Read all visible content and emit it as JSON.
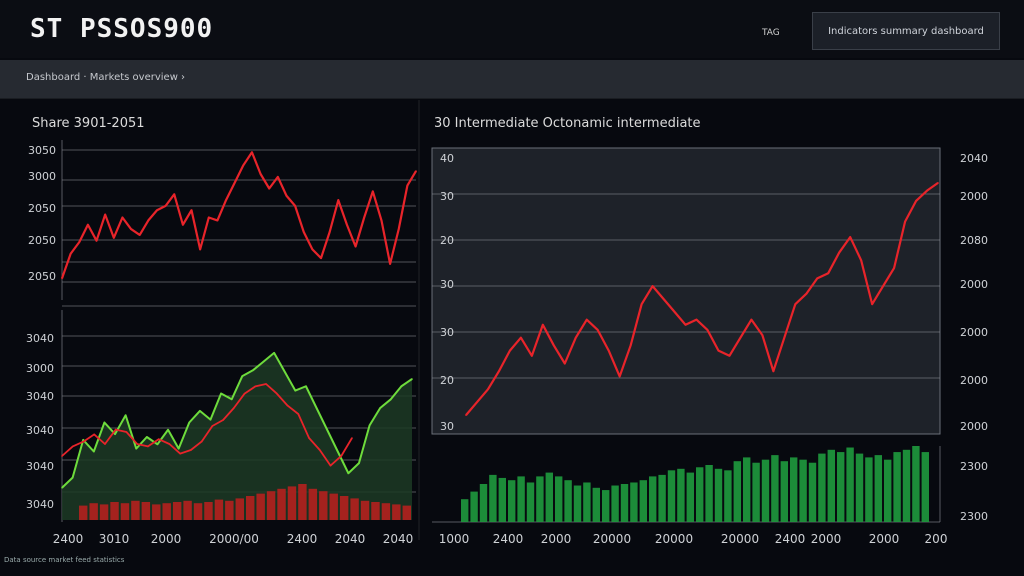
{
  "header": {
    "title": "ST PSSOS900",
    "right_label": "TAG",
    "action_button": "Indicators summary dashboard"
  },
  "subnav": {
    "breadcrumb": "Dashboard  ·  Markets overview ›"
  },
  "footer": {
    "text": "Data source market feed statistics"
  },
  "colors": {
    "red": "#e8242a",
    "green": "#6edc3c",
    "dark_green": "#1c3a24",
    "bar_red": "#b5201e",
    "bar_green": "#1f9b3e",
    "grid": "#8c8f96"
  },
  "chart_data": [
    {
      "type": "line",
      "title": "Share 3901-2051",
      "y_tick_labels": [
        "3050",
        "3000",
        "2050",
        "2050",
        "2050"
      ],
      "grid": true,
      "series": [
        {
          "color": "red",
          "values": [
            0.08,
            0.25,
            0.33,
            0.45,
            0.34,
            0.52,
            0.36,
            0.5,
            0.42,
            0.38,
            0.48,
            0.55,
            0.58,
            0.66,
            0.45,
            0.55,
            0.28,
            0.5,
            0.48,
            0.62,
            0.74,
            0.86,
            0.95,
            0.8,
            0.7,
            0.78,
            0.65,
            0.58,
            0.4,
            0.28,
            0.22,
            0.4,
            0.62,
            0.45,
            0.3,
            0.5,
            0.68,
            0.48,
            0.18,
            0.42,
            0.72,
            0.82
          ]
        }
      ]
    },
    {
      "type": "area",
      "y_tick_labels": [
        "3040",
        "3000",
        "3040",
        "3040",
        "3040",
        "3040"
      ],
      "x_tick_labels": [
        "2400",
        "3010",
        "2000",
        "2000/00",
        "2400",
        "2040",
        "2040"
      ],
      "grid": true,
      "series": [
        {
          "color": "green",
          "values": [
            0.05,
            0.12,
            0.38,
            0.3,
            0.5,
            0.42,
            0.55,
            0.32,
            0.4,
            0.35,
            0.45,
            0.32,
            0.5,
            0.58,
            0.52,
            0.7,
            0.66,
            0.82,
            0.86,
            0.92,
            0.98,
            0.85,
            0.72,
            0.75,
            0.6,
            0.45,
            0.3,
            0.15,
            0.22,
            0.48,
            0.6,
            0.66,
            0.75,
            0.8
          ]
        },
        {
          "color": "red",
          "values": [
            0.2,
            0.28,
            0.32,
            0.38,
            0.3,
            0.42,
            0.4,
            0.3,
            0.28,
            0.34,
            0.3,
            0.22,
            0.25,
            0.32,
            0.45,
            0.5,
            0.6,
            0.72,
            0.78,
            0.8,
            0.72,
            0.62,
            0.55,
            0.35,
            0.25,
            0.12,
            0.2,
            0.35
          ]
        }
      ],
      "volume": [
        0.12,
        0.14,
        0.13,
        0.15,
        0.14,
        0.16,
        0.15,
        0.13,
        0.14,
        0.15,
        0.16,
        0.14,
        0.15,
        0.17,
        0.16,
        0.18,
        0.2,
        0.22,
        0.24,
        0.26,
        0.28,
        0.3,
        0.26,
        0.24,
        0.22,
        0.2,
        0.18,
        0.16,
        0.15,
        0.14,
        0.13,
        0.12
      ]
    },
    {
      "type": "line",
      "title": "30 Intermediate Octonamic intermediate",
      "y_tick_labels": [
        "40",
        "30",
        "20",
        "30",
        "30",
        "20",
        "30"
      ],
      "y2_tick_labels": [
        "2040",
        "2000",
        "2080",
        "2000",
        "2000",
        "2000",
        "2000"
      ],
      "grid": true,
      "series": [
        {
          "color": "red",
          "values": [
            0.05,
            0.1,
            0.15,
            0.22,
            0.3,
            0.35,
            0.28,
            0.4,
            0.32,
            0.25,
            0.35,
            0.42,
            0.38,
            0.3,
            0.2,
            0.32,
            0.48,
            0.55,
            0.5,
            0.45,
            0.4,
            0.42,
            0.38,
            0.3,
            0.28,
            0.35,
            0.42,
            0.36,
            0.22,
            0.35,
            0.48,
            0.52,
            0.58,
            0.6,
            0.68,
            0.74,
            0.65,
            0.48,
            0.55,
            0.62,
            0.8,
            0.88,
            0.92,
            0.95
          ]
        }
      ]
    },
    {
      "type": "bar",
      "y_tick_labels": [
        "2300",
        "2300"
      ],
      "x_tick_labels": [
        "1000",
        "2400",
        "2000",
        "20000",
        "20000",
        "20000",
        "2400",
        "2000",
        "2000",
        "200"
      ],
      "values": [
        0.3,
        0.4,
        0.5,
        0.62,
        0.58,
        0.55,
        0.6,
        0.52,
        0.6,
        0.65,
        0.6,
        0.55,
        0.48,
        0.52,
        0.45,
        0.42,
        0.48,
        0.5,
        0.52,
        0.55,
        0.6,
        0.62,
        0.68,
        0.7,
        0.65,
        0.72,
        0.75,
        0.7,
        0.68,
        0.8,
        0.85,
        0.78,
        0.82,
        0.88,
        0.8,
        0.85,
        0.82,
        0.78,
        0.9,
        0.95,
        0.92,
        0.98,
        0.9,
        0.85,
        0.88,
        0.82,
        0.92,
        0.95,
        1.0,
        0.92
      ]
    }
  ]
}
